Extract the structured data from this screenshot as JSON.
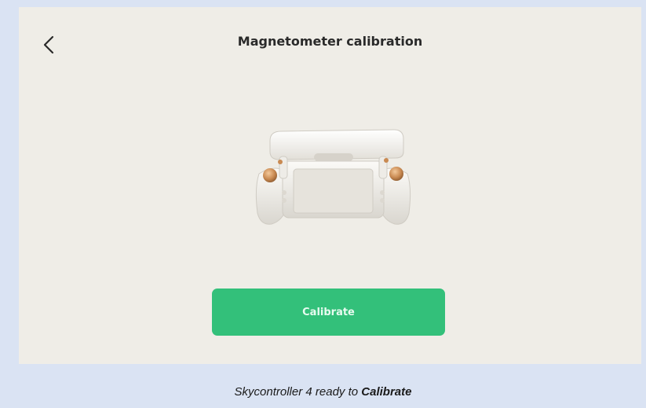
{
  "header": {
    "back_icon": "chevron-left-icon",
    "title": "Magnetometer calibration"
  },
  "main": {
    "device_image": "skycontroller-illustration",
    "calibrate_label": "Calibrate"
  },
  "caption": {
    "prefix": "Skycontroller 4 ready to ",
    "emphasis": "Calibrate"
  },
  "colors": {
    "page_background": "#dae3f3",
    "screen_background": "#efede7",
    "accent_green": "#33c07a"
  }
}
